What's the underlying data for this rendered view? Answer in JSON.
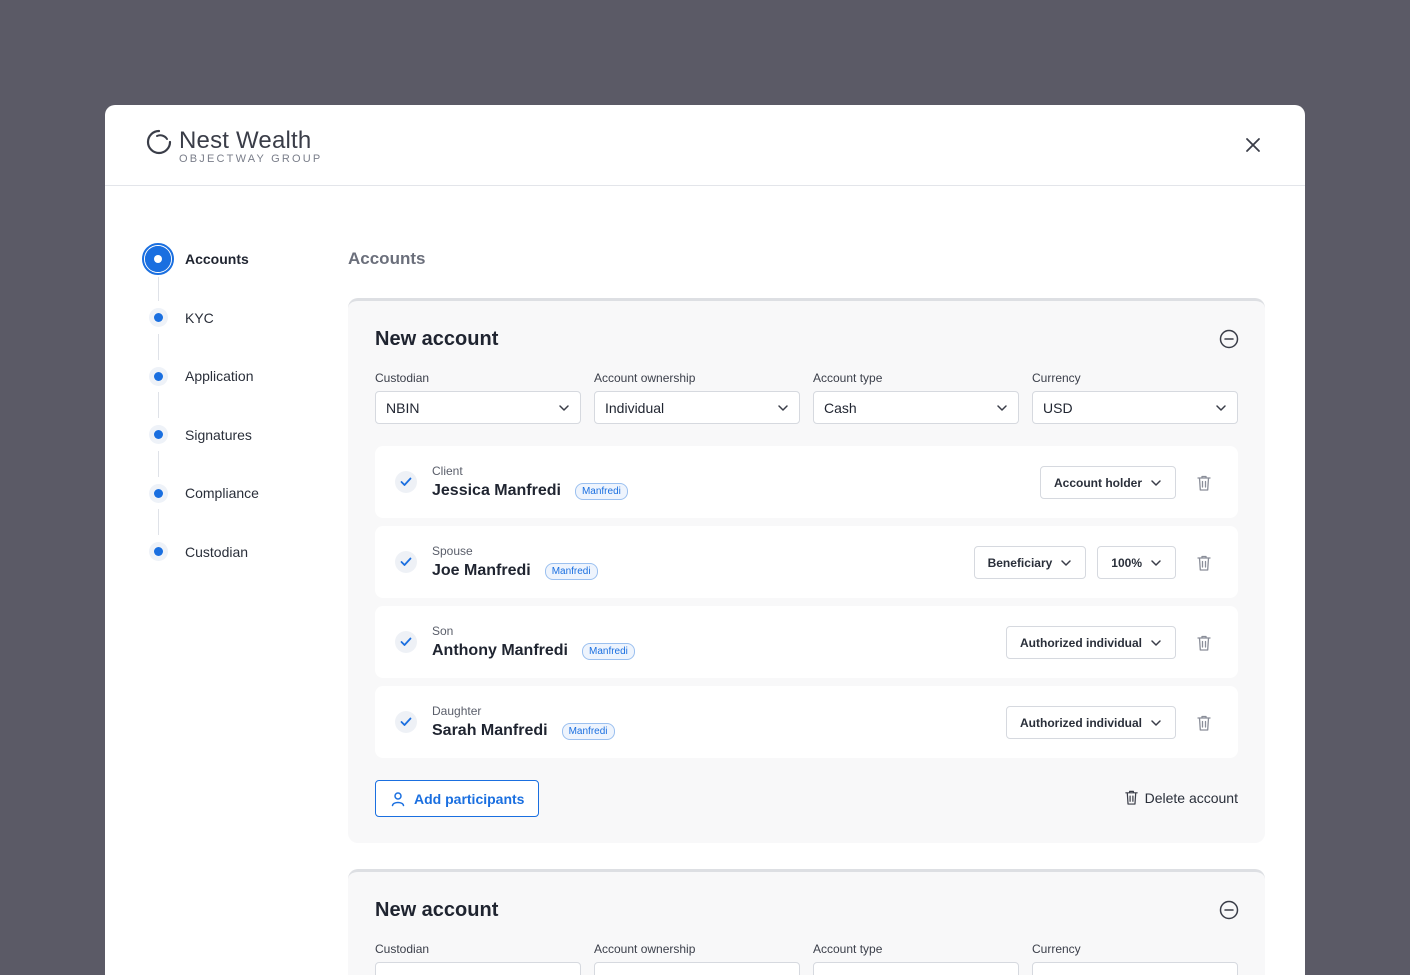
{
  "brand": {
    "name": "Nest Wealth",
    "subtitle": "OBJECTWAY GROUP"
  },
  "steps": [
    {
      "label": "Accounts",
      "active": true
    },
    {
      "label": "KYC"
    },
    {
      "label": "Application"
    },
    {
      "label": "Signatures"
    },
    {
      "label": "Compliance"
    },
    {
      "label": "Custodian"
    }
  ],
  "section_title": "Accounts",
  "accounts": [
    {
      "title": "New account",
      "fields": {
        "custodian": {
          "label": "Custodian",
          "value": "NBIN"
        },
        "ownership": {
          "label": "Account ownership",
          "value": "Individual"
        },
        "type": {
          "label": "Account type",
          "value": "Cash"
        },
        "currency": {
          "label": "Currency",
          "value": "USD"
        }
      },
      "participants": [
        {
          "role": "Client",
          "name": "Jessica Manfredi",
          "tag": "Manfredi",
          "relation": "Account holder"
        },
        {
          "role": "Spouse",
          "name": "Joe Manfredi",
          "tag": "Manfredi",
          "relation": "Beneficiary",
          "share": "100%"
        },
        {
          "role": "Son",
          "name": "Anthony Manfredi",
          "tag": "Manfredi",
          "relation": "Authorized individual"
        },
        {
          "role": "Daughter",
          "name": "Sarah Manfredi",
          "tag": "Manfredi",
          "relation": "Authorized individual"
        }
      ],
      "add_participants_label": "Add participants",
      "delete_account_label": "Delete account"
    },
    {
      "title": "New account",
      "fields": {
        "custodian": {
          "label": "Custodian"
        },
        "ownership": {
          "label": "Account ownership"
        },
        "type": {
          "label": "Account type"
        },
        "currency": {
          "label": "Currency"
        }
      }
    }
  ],
  "colors": {
    "accent": "#1a6fe0",
    "backdrop": "#5b5a66",
    "card": "#f8f8f9"
  },
  "icons": [
    "brand-logo-icon",
    "close-icon",
    "collapse-icon",
    "chevron-down-icon",
    "check-icon",
    "trash-icon",
    "user-icon"
  ]
}
